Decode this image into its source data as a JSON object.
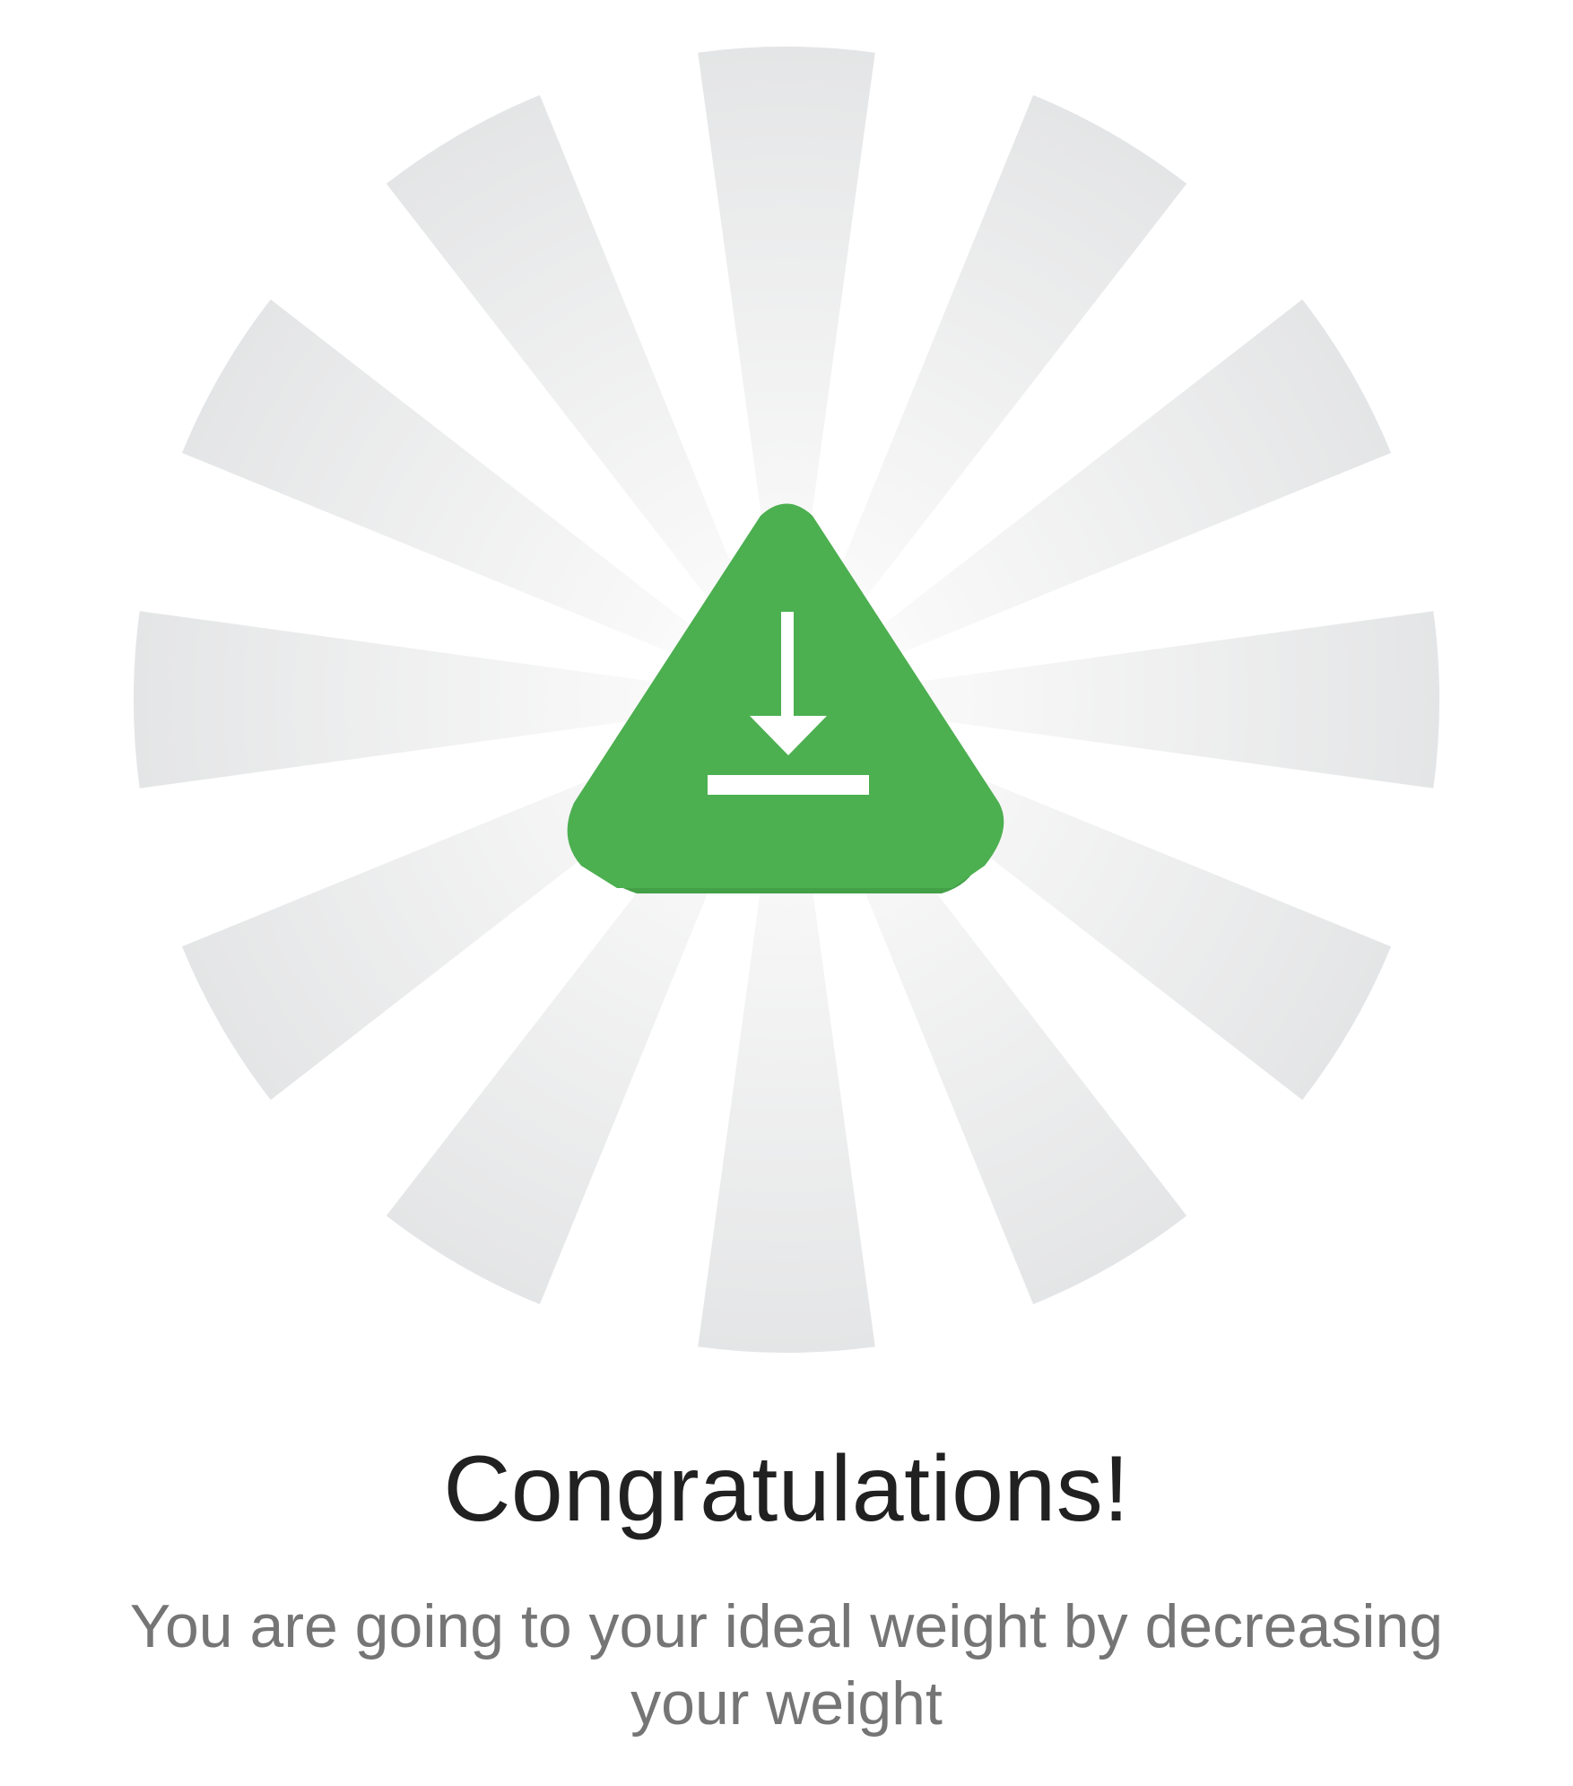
{
  "dialog": {
    "title": "Congratulations!",
    "message": "You are going to your ideal weight by decreasing your weight"
  },
  "badge": {
    "icon": "download-arrow-icon",
    "color": "#4CAF50",
    "shade": "#43A047"
  },
  "burst": {
    "ray_color": "#E6E7E8",
    "ray_count": 12
  }
}
